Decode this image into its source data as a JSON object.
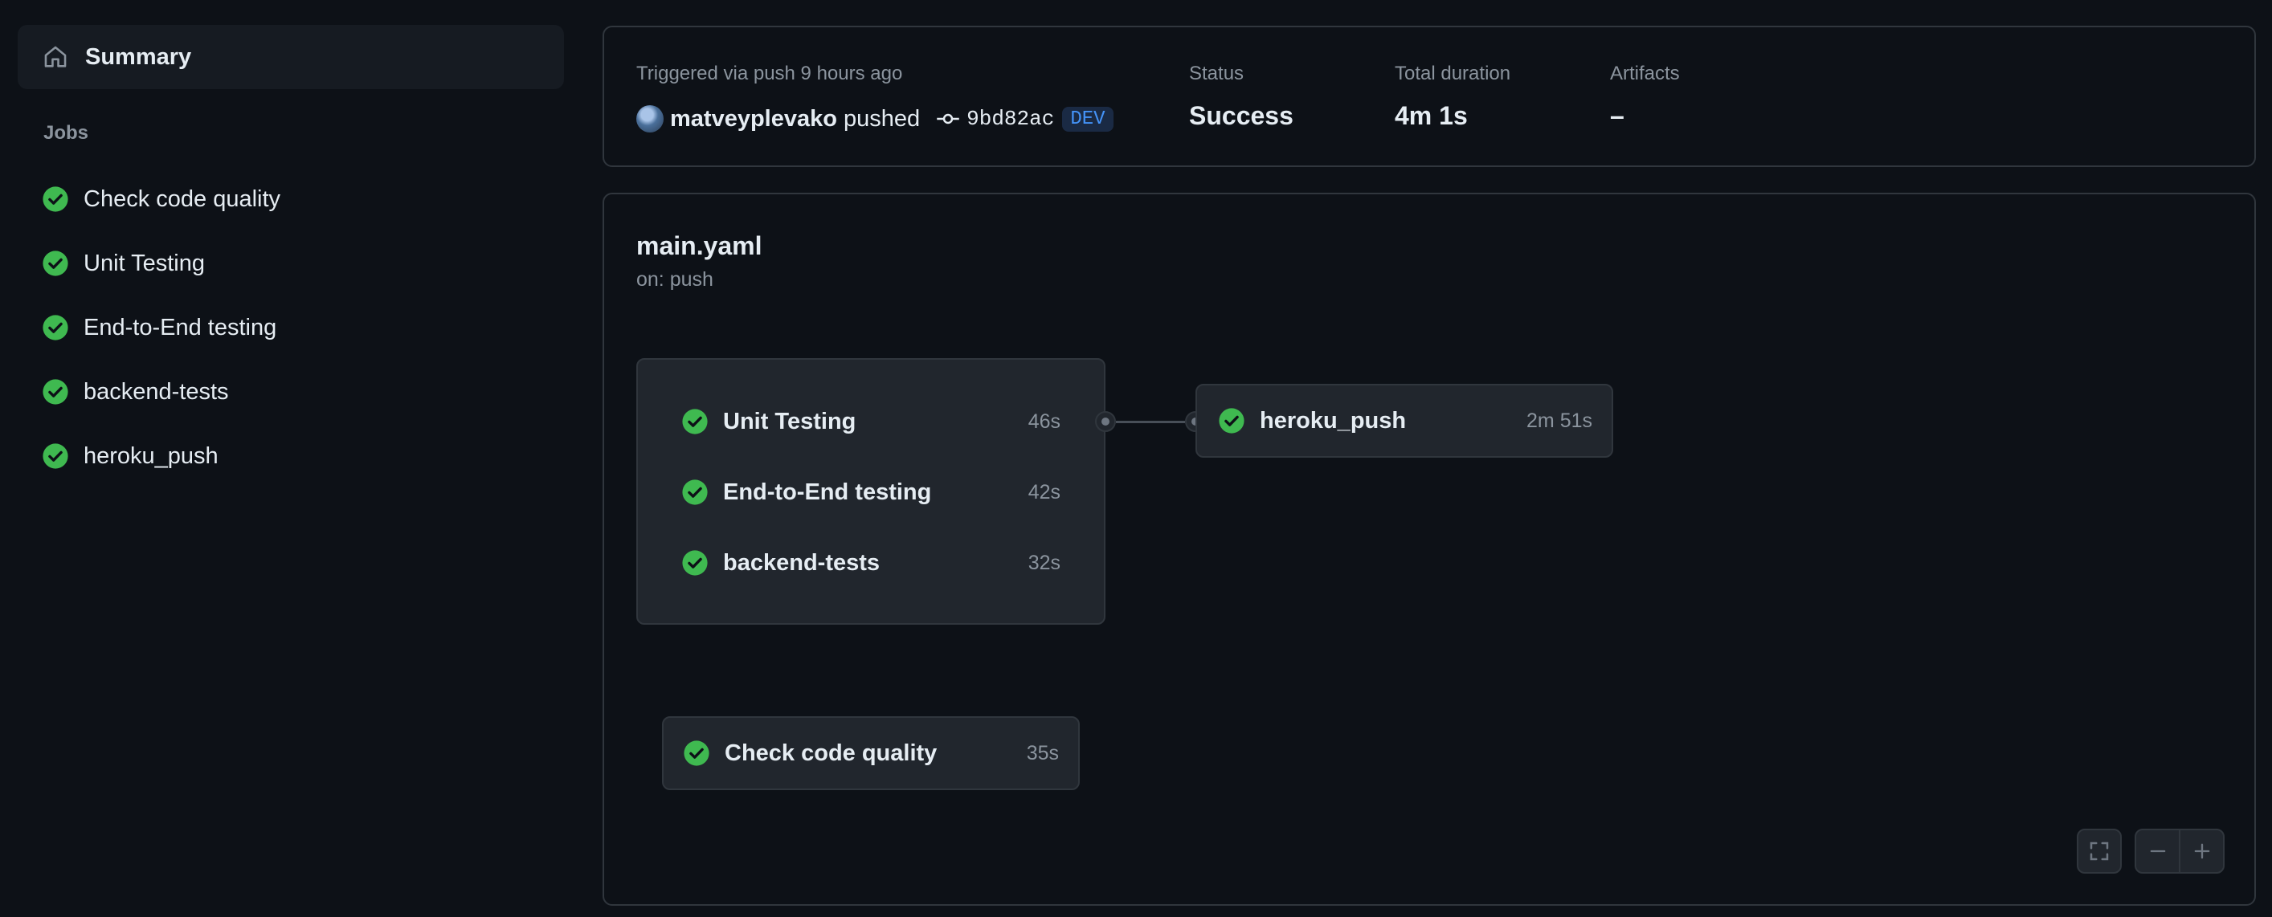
{
  "sidebar": {
    "summary_label": "Summary",
    "jobs_heading": "Jobs",
    "jobs": [
      {
        "label": "Check code quality",
        "status": "success"
      },
      {
        "label": "Unit Testing",
        "status": "success"
      },
      {
        "label": "End-to-End testing",
        "status": "success"
      },
      {
        "label": "backend-tests",
        "status": "success"
      },
      {
        "label": "heroku_push",
        "status": "success"
      }
    ]
  },
  "run": {
    "trigger_text": "Triggered via push 9 hours ago",
    "actor": "matveyplevako",
    "pushed_text": "pushed",
    "commit_sha": "9bd82ac",
    "branch": "DEV",
    "status_label": "Status",
    "status_value": "Success",
    "duration_label": "Total duration",
    "duration_value": "4m 1s",
    "artifacts_label": "Artifacts",
    "artifacts_value": "–"
  },
  "workflow": {
    "file": "main.yaml",
    "trigger": "on: push",
    "group_jobs": [
      {
        "name": "Unit Testing",
        "duration": "46s"
      },
      {
        "name": "End-to-End testing",
        "duration": "42s"
      },
      {
        "name": "backend-tests",
        "duration": "32s"
      }
    ],
    "downstream_job": {
      "name": "heroku_push",
      "duration": "2m 51s"
    },
    "standalone_job": {
      "name": "Check code quality",
      "duration": "35s"
    }
  },
  "colors": {
    "success": "#3fb950",
    "background": "#0d1117",
    "panel": "#21262d",
    "border": "#30363d",
    "muted": "#8b949e",
    "branch": "#4493f8"
  },
  "icons": {
    "summary": "home-icon",
    "job_status": "check-circle-icon",
    "commit": "git-commit-icon",
    "fullscreen": "fullscreen-icon",
    "zoom_out": "zoom-out-icon",
    "zoom_in": "zoom-in-icon"
  }
}
